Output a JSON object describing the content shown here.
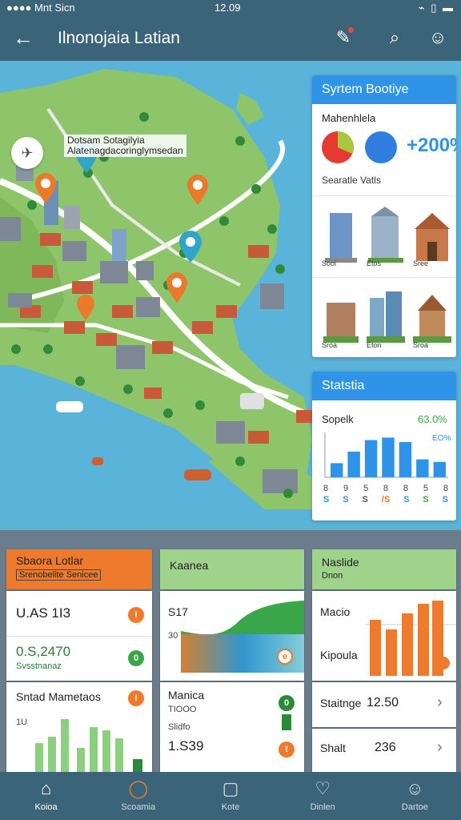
{
  "status_bar": {
    "carrier": "Mnt Sicn",
    "time": "12.09"
  },
  "app_bar": {
    "title": "Ilnonojaia Latian",
    "back_icon": "arrow-left-icon",
    "actions": [
      "edit-pin-icon",
      "search-icon",
      "user-icon"
    ]
  },
  "map": {
    "label_line1": "Dotsam Sotagilyia",
    "label_line2": "Alatenagdacoringlymsedan"
  },
  "system_card": {
    "title": "Syrtem Bootiye",
    "subtitle": "Mahenhlela",
    "percent": "+200%",
    "values_label": "Searatle Vatls",
    "buildings_row1": [
      "Sooi",
      "Etos",
      "Sree"
    ],
    "buildings_row2": [
      "Sroa",
      "Eton",
      "Sroa"
    ]
  },
  "stats_card": {
    "title": "Statstia",
    "subtitle": "Sopelk",
    "percent": "63.0%",
    "percent_small": "EO%",
    "chart_data": {
      "type": "bar",
      "values": [
        22,
        40,
        58,
        62,
        55,
        28,
        24
      ],
      "ylim": [
        0,
        70
      ]
    },
    "tick_row1": [
      "8",
      "9",
      "5",
      "8",
      "8",
      "5",
      "8"
    ],
    "tick_row2": [
      "S",
      "S",
      "S",
      "/S",
      "S",
      "S",
      "S"
    ]
  },
  "panel": {
    "orange": {
      "title": "Sbaora Lotlar",
      "subtitle": "Srenobelite Senicee"
    },
    "green_mid": {
      "title": "Kaanea"
    },
    "green_right": {
      "title": "Naslide",
      "subtitle": "Dnon"
    },
    "row1_left": {
      "value": "U.AS 1I3"
    },
    "row2_left": {
      "value": "0.S,2470",
      "sub": "Svsstnanaz"
    },
    "row3_left": {
      "title": "Sntad Mametaos",
      "sub": "1U"
    },
    "mid_top": {
      "value": "S17",
      "axis": "30"
    },
    "mid_bottom": {
      "title": "Manica",
      "line1": "TIOOO",
      "line2": "Slidfo",
      "value": "1.S39"
    },
    "right_top": {
      "label1": "Macio",
      "label2": "Kipoula"
    },
    "right_row1": {
      "label": "Staitnge",
      "value": "12.50"
    },
    "right_row2": {
      "label": "Shalt",
      "value": "236"
    }
  },
  "bottom_nav": {
    "items": [
      {
        "label": "Koioa",
        "icon": "home-icon",
        "active": true
      },
      {
        "label": "Scoamia",
        "icon": "bubble-icon",
        "active": false
      },
      {
        "label": "Kote",
        "icon": "chart-box-icon",
        "active": false
      },
      {
        "label": "Dinlen",
        "icon": "heart-icon",
        "active": false
      },
      {
        "label": "Dartoe",
        "icon": "person-icon",
        "active": false
      }
    ]
  }
}
